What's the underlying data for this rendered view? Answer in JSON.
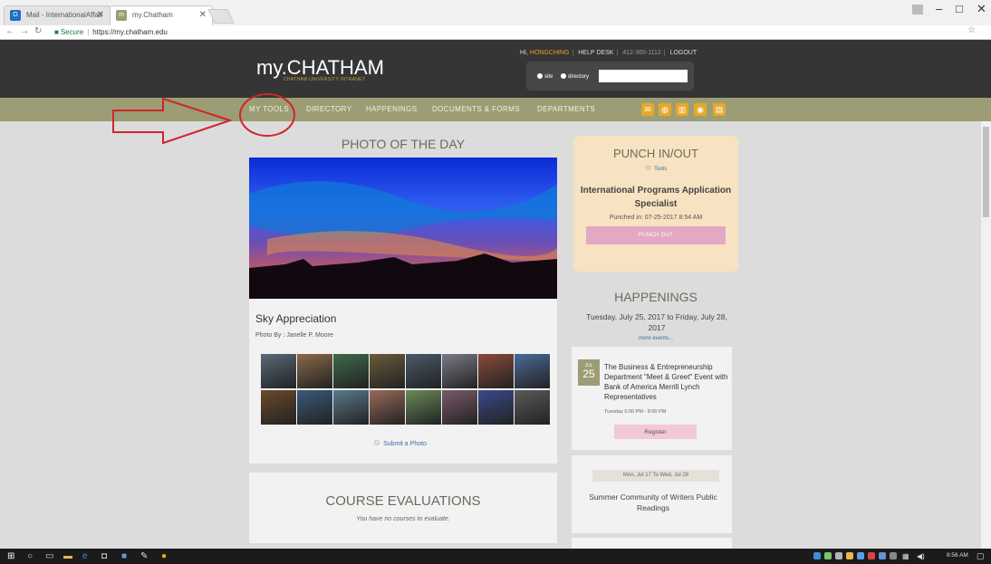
{
  "browser": {
    "tabs": [
      {
        "label": "Mail - InternationalAffair",
        "icon": "outlook-icon",
        "active": false
      },
      {
        "label": "my.Chatham",
        "icon": "chatham-icon",
        "active": true
      }
    ],
    "url_secure_label": "Secure",
    "url": "https://my.chatham.edu"
  },
  "header": {
    "logo": "my.CHATHAM",
    "logo_sub": "CHATHAM UNIVERSITY INTRANET",
    "greeting": "HI,",
    "username": "HONGCHING",
    "help_desk": "HELP DESK",
    "phone": "412-365-1112",
    "logout": "LOGOUT",
    "search_options": [
      "site",
      "directory"
    ]
  },
  "nav": {
    "items": [
      "MY TOOLS",
      "DIRECTORY",
      "HAPPENINGS",
      "DOCUMENTS & FORMS",
      "DEPARTMENTS"
    ],
    "icons": [
      "mail-icon",
      "globe-icon",
      "chart-icon",
      "help-icon",
      "calendar-icon"
    ],
    "accent": "#e7a829"
  },
  "photo": {
    "section_title": "PHOTO OF THE DAY",
    "caption": "Sky Appreciation",
    "by": "Photo By : Janelle P. Moore",
    "submit": "Submit a Photo"
  },
  "course": {
    "title": "COURSE EVALUATIONS",
    "message": "You have no courses to evaluate."
  },
  "punch": {
    "title": "PUNCH IN/OUT",
    "tools": "Tools",
    "role": "International Programs Application Specialist",
    "punched_in": "Punched in: 07-25-2017 8:54 AM",
    "button": "PUNCH OUT"
  },
  "happenings": {
    "title": "HAPPENINGS",
    "range": "Tuesday, July 25, 2017 to Friday, July 28, 2017",
    "more": "more events...",
    "event1": {
      "month": "JUL",
      "day": "25",
      "title": "The Business & Entrepreneurship Department \"Meet & Greet\" Event with Bank of America Merrill Lynch Representatives",
      "time": "Tuesday 5:00 PM - 8:00 PM",
      "register": "Register"
    },
    "event2": {
      "date": "Mon, Jul 17  To  Wed, Jul 26",
      "title": "Summer Community of Writers Public Readings"
    }
  },
  "taskbar": {
    "time": "8:56 AM"
  }
}
